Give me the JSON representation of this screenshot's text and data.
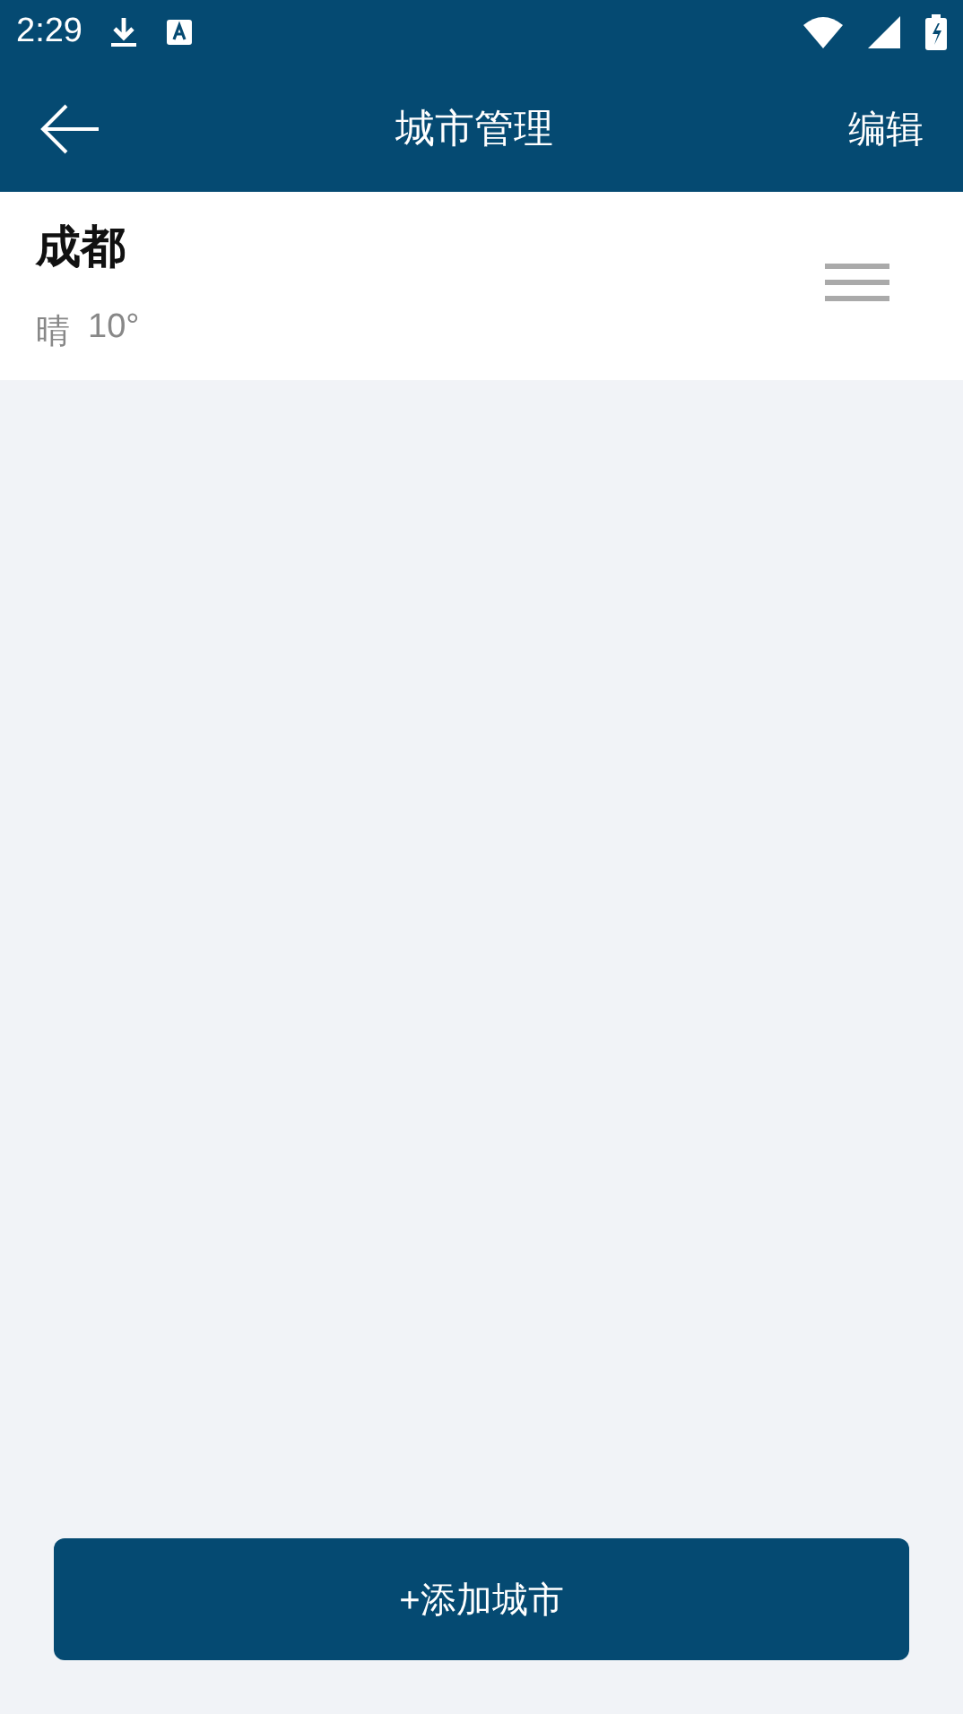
{
  "status_bar": {
    "time": "2:29"
  },
  "toolbar": {
    "title": "城市管理",
    "action": "编辑"
  },
  "cities": [
    {
      "name": "成都",
      "weather": "晴",
      "temperature": "10°"
    }
  ],
  "add_button": "+添加城市"
}
